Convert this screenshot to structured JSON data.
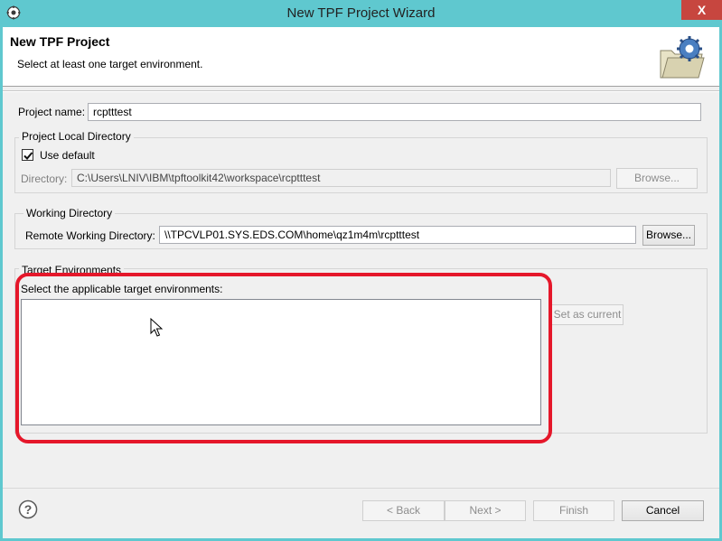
{
  "window": {
    "title": "New TPF Project Wizard",
    "close_glyph": "X"
  },
  "header": {
    "title": "New TPF Project",
    "description": "Select at least one target environment."
  },
  "project_name": {
    "label": "Project name:",
    "value": "rcptttest"
  },
  "local_dir": {
    "group_title": "Project Local Directory",
    "use_default_label": "Use default",
    "use_default_checked": true,
    "directory_label": "Directory:",
    "directory_value": "C:\\Users\\LNIV\\IBM\\tpftoolkit42\\workspace\\rcptttest",
    "browse_label": "Browse..."
  },
  "working_dir": {
    "group_title": "Working Directory",
    "remote_label": "Remote Working Directory:",
    "remote_value": "\\\\TPCVLP01.SYS.EDS.COM\\home\\qz1m4m\\rcptttest",
    "browse_label": "Browse..."
  },
  "target_envs": {
    "group_title": "Target Environments",
    "instruction": "Select the applicable target environments:",
    "set_current_label": "Set as current"
  },
  "footer": {
    "back_label": "< Back",
    "next_label": "Next >",
    "finish_label": "Finish",
    "cancel_label": "Cancel"
  },
  "colors": {
    "titlebar": "#5fc8cf",
    "close_button": "#c7463f",
    "highlight": "#e5172a"
  },
  "icons": [
    "app-icon",
    "wizard-folder-gear-icon",
    "help-icon",
    "mouse-cursor-icon"
  ]
}
